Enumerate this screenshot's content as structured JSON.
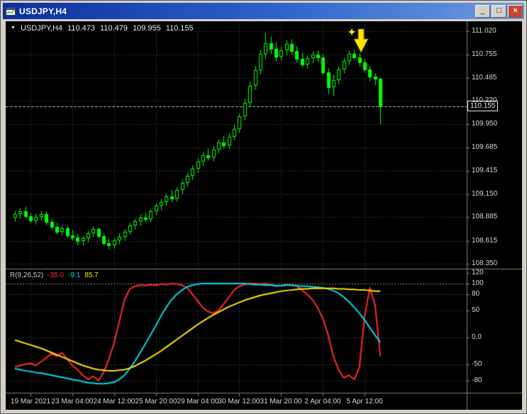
{
  "window": {
    "title": "USDJPY,H4",
    "buttons": {
      "minimize": "_",
      "restore": "□",
      "close": "×"
    }
  },
  "icons": {
    "symbol_dropdown": "▼"
  },
  "chart": {
    "info": {
      "symbol": "USDJPY,H4",
      "open": "110.473",
      "high": "110.479",
      "low": "109.955",
      "close": "110.155"
    },
    "current_price": "110.155",
    "price_axis": [
      "111.020",
      "110.755",
      "110.485",
      "110.220",
      "109.950",
      "109.685",
      "109.415",
      "109.150",
      "108.885",
      "108.615",
      "108.350"
    ],
    "time_axis": [
      "19 Mar 2021",
      "23 Mar 04:00",
      "24 Mar 12:00",
      "25 Mar 20:00",
      "29 Mar 04:00",
      "30 Mar 12:00",
      "31 Mar 20:00",
      "2 Apr 04:00",
      "5 Apr 12:00"
    ]
  },
  "indicator": {
    "name": "R(9,26,52)",
    "values": [
      "-35.0",
      "-9.1",
      "85.7"
    ],
    "value_colors": [
      "#ff2a2a",
      "#00d9e9",
      "#ffe400"
    ],
    "axis": [
      "120",
      "100",
      "80",
      "50",
      "0.0",
      "-50",
      "-80"
    ]
  },
  "colors": {
    "background": "#000000",
    "grid": "#2f2f2f",
    "level_major": "#8a8a8a",
    "separator": "#808080",
    "candle": "#00ff00",
    "bid_line": "#b8b8b8",
    "axis_text": "#d6d6d6",
    "info_text": "#e8e8e8",
    "indicator_text": "#c8c8c8",
    "annotation": "#ffe400",
    "titlebar_left": "#0c2f9a",
    "titlebar_mid": "#2e66cc",
    "titlebar_right": "#6f9ce0",
    "close_button": "#c8432d"
  },
  "chart_data": [
    {
      "type": "candlestick",
      "symbol": "USDJPY",
      "timeframe": "H4",
      "ylim": [
        108.302,
        111.134
      ],
      "y_ticks": [
        111.02,
        110.755,
        110.485,
        110.22,
        109.95,
        109.685,
        109.415,
        109.15,
        108.885,
        108.615,
        108.35
      ],
      "x_tick_indices": [
        3,
        11,
        19,
        27,
        35,
        43,
        51,
        59,
        67
      ],
      "x_tick_labels": [
        "19 Mar 2021",
        "23 Mar 04:00",
        "24 Mar 12:00",
        "25 Mar 20:00",
        "29 Mar 04:00",
        "30 Mar 12:00",
        "31 Mar 20:00",
        "2 Apr 04:00",
        "5 Apr 12:00"
      ],
      "current_price": 110.155,
      "ohlc": [
        [
          108.88,
          108.96,
          108.84,
          108.92
        ],
        [
          108.92,
          108.99,
          108.87,
          108.95
        ],
        [
          108.95,
          109.01,
          108.88,
          108.9
        ],
        [
          108.9,
          108.94,
          108.82,
          108.85
        ],
        [
          108.85,
          108.93,
          108.81,
          108.89
        ],
        [
          108.89,
          108.96,
          108.85,
          108.92
        ],
        [
          108.92,
          108.95,
          108.8,
          108.83
        ],
        [
          108.83,
          108.87,
          108.74,
          108.77
        ],
        [
          108.77,
          108.82,
          108.69,
          108.72
        ],
        [
          108.72,
          108.8,
          108.68,
          108.76
        ],
        [
          108.76,
          108.79,
          108.65,
          108.68
        ],
        [
          108.68,
          108.74,
          108.62,
          108.65
        ],
        [
          108.65,
          108.7,
          108.57,
          108.61
        ],
        [
          108.61,
          108.68,
          108.56,
          108.64
        ],
        [
          108.64,
          108.73,
          108.6,
          108.7
        ],
        [
          108.7,
          108.78,
          108.66,
          108.75
        ],
        [
          108.75,
          108.77,
          108.64,
          108.67
        ],
        [
          108.67,
          108.7,
          108.56,
          108.59
        ],
        [
          108.59,
          108.64,
          108.52,
          108.56
        ],
        [
          108.56,
          108.65,
          108.53,
          108.62
        ],
        [
          108.62,
          108.7,
          108.58,
          108.66
        ],
        [
          108.66,
          108.75,
          108.62,
          108.72
        ],
        [
          108.72,
          108.82,
          108.69,
          108.79
        ],
        [
          108.79,
          108.87,
          108.75,
          108.84
        ],
        [
          108.84,
          108.92,
          108.79,
          108.88
        ],
        [
          108.88,
          108.94,
          108.82,
          108.86
        ],
        [
          108.86,
          108.98,
          108.83,
          108.95
        ],
        [
          108.95,
          109.05,
          108.91,
          109.02
        ],
        [
          109.02,
          109.1,
          108.97,
          109.06
        ],
        [
          109.06,
          109.16,
          109.02,
          109.12
        ],
        [
          109.12,
          109.2,
          109.06,
          109.1
        ],
        [
          109.1,
          109.24,
          109.07,
          109.2
        ],
        [
          109.2,
          109.32,
          109.16,
          109.28
        ],
        [
          109.28,
          109.4,
          109.24,
          109.36
        ],
        [
          109.36,
          109.48,
          109.32,
          109.44
        ],
        [
          109.44,
          109.56,
          109.4,
          109.52
        ],
        [
          109.52,
          109.64,
          109.47,
          109.6
        ],
        [
          109.6,
          109.68,
          109.54,
          109.57
        ],
        [
          109.57,
          109.7,
          109.53,
          109.66
        ],
        [
          109.66,
          109.78,
          109.62,
          109.74
        ],
        [
          109.74,
          109.82,
          109.68,
          109.71
        ],
        [
          109.71,
          109.85,
          109.67,
          109.81
        ],
        [
          109.81,
          109.95,
          109.77,
          109.9
        ],
        [
          109.9,
          110.08,
          109.86,
          110.04
        ],
        [
          110.04,
          110.25,
          110.0,
          110.2
        ],
        [
          110.2,
          110.44,
          110.16,
          110.39
        ],
        [
          110.39,
          110.62,
          110.35,
          110.57
        ],
        [
          110.57,
          110.81,
          110.53,
          110.76
        ],
        [
          110.76,
          111.0,
          110.7,
          110.88
        ],
        [
          110.88,
          110.96,
          110.76,
          110.82
        ],
        [
          110.82,
          110.9,
          110.68,
          110.73
        ],
        [
          110.73,
          110.85,
          110.69,
          110.8
        ],
        [
          110.8,
          110.92,
          110.74,
          110.87
        ],
        [
          110.87,
          110.93,
          110.75,
          110.79
        ],
        [
          110.79,
          110.85,
          110.66,
          110.7
        ],
        [
          110.7,
          110.78,
          110.61,
          110.64
        ],
        [
          110.64,
          110.74,
          110.6,
          110.71
        ],
        [
          110.71,
          110.79,
          110.65,
          110.75
        ],
        [
          110.75,
          110.81,
          110.67,
          110.72
        ],
        [
          110.72,
          110.76,
          110.52,
          110.55
        ],
        [
          110.55,
          110.6,
          110.3,
          110.38
        ],
        [
          110.38,
          110.52,
          110.28,
          110.46
        ],
        [
          110.46,
          110.62,
          110.42,
          110.58
        ],
        [
          110.58,
          110.72,
          110.54,
          110.68
        ],
        [
          110.68,
          110.8,
          110.64,
          110.76
        ],
        [
          110.76,
          110.82,
          110.7,
          110.72
        ],
        [
          110.72,
          110.77,
          110.62,
          110.66
        ],
        [
          110.66,
          110.7,
          110.55,
          110.58
        ],
        [
          110.58,
          110.62,
          110.45,
          110.5
        ],
        [
          110.5,
          110.54,
          110.4,
          110.473
        ],
        [
          110.473,
          110.479,
          109.955,
          110.155
        ]
      ],
      "annotations": [
        {
          "type": "arrow-down",
          "index": 66,
          "price": 110.78,
          "color": "#ffe400"
        }
      ]
    },
    {
      "type": "line",
      "title": "R(9,26,52)",
      "ylim": [
        -100,
        125
      ],
      "y_ticks": [
        120,
        100,
        80,
        50,
        0,
        -50,
        -80
      ],
      "levels": [
        100,
        80,
        50,
        0,
        -50,
        -80
      ],
      "last_values": [
        -35.0,
        -9.1,
        85.7
      ],
      "series": [
        {
          "name": "R(9)",
          "color": "#ff2a2a",
          "values": [
            -55,
            -52,
            -50,
            -48,
            -52,
            -45,
            -38,
            -30,
            -35,
            -28,
            -40,
            -52,
            -60,
            -70,
            -78,
            -72,
            -80,
            -65,
            -40,
            -10,
            30,
            70,
            90,
            95,
            97,
            96,
            98,
            97,
            99,
            98,
            100,
            99,
            97,
            92,
            80,
            68,
            55,
            48,
            45,
            50,
            62,
            75,
            88,
            95,
            98,
            100,
            100,
            99,
            100,
            98,
            95,
            96,
            98,
            97,
            95,
            88,
            80,
            70,
            55,
            35,
            5,
            -35,
            -60,
            -75,
            -70,
            -78,
            -55,
            40,
            92,
            60,
            -35
          ]
        },
        {
          "name": "R(26)",
          "color": "#00d9e9",
          "values": [
            -58,
            -60,
            -62,
            -63,
            -65,
            -66,
            -68,
            -70,
            -72,
            -74,
            -76,
            -78,
            -80,
            -82,
            -84,
            -85,
            -86,
            -86,
            -85,
            -83,
            -78,
            -70,
            -58,
            -44,
            -28,
            -12,
            5,
            22,
            40,
            56,
            70,
            80,
            88,
            94,
            97,
            99,
            100,
            100,
            100,
            100,
            100,
            100,
            100,
            100,
            100,
            99,
            98,
            98,
            97,
            97,
            96,
            96,
            97,
            97,
            96,
            95,
            95,
            94,
            93,
            92,
            90,
            87,
            82,
            75,
            66,
            56,
            45,
            32,
            18,
            4,
            -9.1
          ]
        },
        {
          "name": "R(52)",
          "color": "#ffe400",
          "values": [
            -5,
            -8,
            -11,
            -14,
            -17,
            -20,
            -24,
            -28,
            -32,
            -36,
            -40,
            -44,
            -48,
            -52,
            -55,
            -58,
            -60,
            -61,
            -62,
            -62,
            -61,
            -60,
            -57,
            -53,
            -48,
            -43,
            -37,
            -31,
            -25,
            -18,
            -11,
            -4,
            3,
            10,
            17,
            24,
            30,
            36,
            42,
            47,
            52,
            57,
            61,
            65,
            69,
            72,
            75,
            78,
            80,
            82,
            84,
            86,
            87,
            88,
            89,
            90,
            90,
            91,
            91,
            91,
            91,
            91,
            90,
            90,
            89,
            89,
            88,
            88,
            87,
            86,
            85.7
          ]
        }
      ]
    }
  ]
}
